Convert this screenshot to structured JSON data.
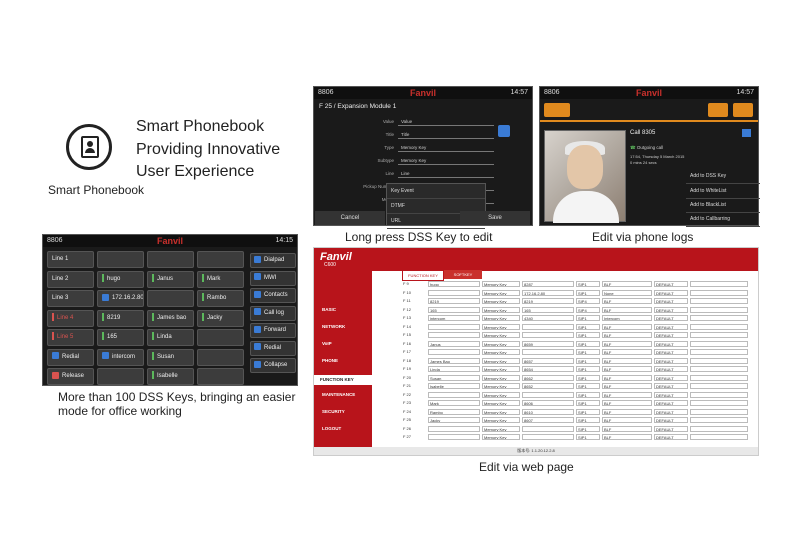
{
  "intro": {
    "icon_caption": "Smart Phonebook",
    "headline": [
      "Smart Phonebook",
      "Providing Innovative",
      "User Experience"
    ]
  },
  "dss_screen": {
    "status_left": "8806",
    "brand": "Fanvil",
    "time": "14:15",
    "cells": [
      {
        "label": "Line 1",
        "led": "none"
      },
      {
        "label": "",
        "led": "none"
      },
      {
        "label": "",
        "led": "none"
      },
      {
        "label": "",
        "led": "none"
      },
      {
        "label": "Line 2",
        "led": "none"
      },
      {
        "label": "hugo",
        "led": "green"
      },
      {
        "label": "Janus",
        "led": "green"
      },
      {
        "label": "Mark",
        "led": "green"
      },
      {
        "label": "Line 3",
        "led": "none"
      },
      {
        "label": "172.16.2.80",
        "led": "icon"
      },
      {
        "label": "",
        "led": "none"
      },
      {
        "label": "Rambo",
        "led": "green"
      },
      {
        "label": "Line 4",
        "led": "red"
      },
      {
        "label": "8219",
        "led": "green"
      },
      {
        "label": "James bao",
        "led": "green"
      },
      {
        "label": "Jacky",
        "led": "green"
      },
      {
        "label": "Line 5",
        "led": "red"
      },
      {
        "label": "165",
        "led": "green"
      },
      {
        "label": "Linda",
        "led": "green"
      },
      {
        "label": "",
        "led": "none"
      },
      {
        "label": "Redial",
        "led": "icon"
      },
      {
        "label": "intercom",
        "led": "icon"
      },
      {
        "label": "Susan",
        "led": "green"
      },
      {
        "label": "",
        "led": "none"
      },
      {
        "label": "Release",
        "led": "icon-red"
      },
      {
        "label": "",
        "led": "none"
      },
      {
        "label": "Isabelle",
        "led": "green"
      },
      {
        "label": "",
        "led": "none"
      }
    ],
    "side_buttons": [
      "Dialpad",
      "MWI",
      "Contacts",
      "Call log",
      "Forward",
      "Redial",
      "Collapse"
    ],
    "caption": "More than 100 DSS Keys, bringing an easier mode for office working"
  },
  "expansion_screen": {
    "status_left": "8806",
    "brand": "Fanvil",
    "time": "14:57",
    "title": "F 25 / Expansion Module 1",
    "fields": [
      {
        "label": "Value",
        "value": "Value"
      },
      {
        "label": "Title",
        "value": "Title"
      },
      {
        "label": "Type",
        "value": "Memory Key"
      },
      {
        "label": "Subtype",
        "value": "Memory Key"
      },
      {
        "label": "Line",
        "value": "Line"
      },
      {
        "label": "Pickup Number",
        "value": ""
      },
      {
        "label": "Media",
        "value": ""
      }
    ],
    "dropdown_options": [
      "Key Event",
      "DTMF",
      "URL"
    ],
    "cancel": "Cancel",
    "save": "Save",
    "caption": "Long press DSS Key to edit"
  },
  "logs_screen": {
    "status_left": "8806",
    "brand": "Fanvil",
    "time": "14:57",
    "call_name": "Call 8305",
    "call_status": "Outgoing call",
    "call_time": "17:54, Thursday 5 March 2015",
    "call_duration": "0 mins 24 secs",
    "menu": [
      "Add to DSS Key",
      "Add to WhiteList",
      "Add to BlackList",
      "Add to Callbarring"
    ],
    "caption": "Edit via phone logs"
  },
  "web_screen": {
    "brand": "Fanvil",
    "model": "C600",
    "tabs": [
      "FUNCTION KEY",
      "SOFTKEY"
    ],
    "nav": [
      "BASIC",
      "NETWORK",
      "VoIP",
      "PHONE",
      "FUNCTION KEY",
      "MAINTENANCE",
      "SECURITY",
      "LOGOUT"
    ],
    "rows": [
      {
        "key": "F 9",
        "name": "hugo",
        "type": "Memory Key",
        "num": "8287",
        "line": "SIP1",
        "sub": "BLF",
        "mode": "DEFAULT"
      },
      {
        "key": "F 10",
        "name": "",
        "type": "Memory Key",
        "num": "172.16.2.80",
        "line": "SIP1",
        "sub": "None",
        "mode": "DEFAULT"
      },
      {
        "key": "F 11",
        "name": "8219",
        "type": "Memory Key",
        "num": "8219",
        "line": "SIP4",
        "sub": "BLF",
        "mode": "DEFAULT"
      },
      {
        "key": "F 12",
        "name": "165",
        "type": "Memory Key",
        "num": "165",
        "line": "SIP4",
        "sub": "BLF",
        "mode": "DEFAULT"
      },
      {
        "key": "F 13",
        "name": "intercom",
        "type": "Memory Key",
        "num": "4340",
        "line": "SIP1",
        "sub": "Intercom",
        "mode": "DEFAULT"
      },
      {
        "key": "F 14",
        "name": "",
        "type": "Memory Key",
        "num": "",
        "line": "SIP1",
        "sub": "BLF",
        "mode": "DEFAULT"
      },
      {
        "key": "F 15",
        "name": "",
        "type": "Memory Key",
        "num": "",
        "line": "SIP1",
        "sub": "BLF",
        "mode": "DEFAULT"
      },
      {
        "key": "F 16",
        "name": "Janus",
        "type": "Memory Key",
        "num": "8659",
        "line": "SIP1",
        "sub": "BLF",
        "mode": "DEFAULT"
      },
      {
        "key": "F 17",
        "name": "",
        "type": "Memory Key",
        "num": "",
        "line": "SIP1",
        "sub": "BLF",
        "mode": "DEFAULT"
      },
      {
        "key": "F 18",
        "name": "James Bao",
        "type": "Memory Key",
        "num": "8657",
        "line": "SIP1",
        "sub": "BLF",
        "mode": "DEFAULT"
      },
      {
        "key": "F 19",
        "name": "Linda",
        "type": "Memory Key",
        "num": "8654",
        "line": "SIP1",
        "sub": "BLF",
        "mode": "DEFAULT"
      },
      {
        "key": "F 20",
        "name": "Susan",
        "type": "Memory Key",
        "num": "8662",
        "line": "SIP1",
        "sub": "BLF",
        "mode": "DEFAULT"
      },
      {
        "key": "F 21",
        "name": "Isabelle",
        "type": "Memory Key",
        "num": "8652",
        "line": "SIP1",
        "sub": "BLF",
        "mode": "DEFAULT"
      },
      {
        "key": "F 22",
        "name": "",
        "type": "Memory Key",
        "num": "",
        "line": "SIP1",
        "sub": "BLF",
        "mode": "DEFAULT"
      },
      {
        "key": "F 23",
        "name": "Mark",
        "type": "Memory Key",
        "num": "8606",
        "line": "SIP1",
        "sub": "BLF",
        "mode": "DEFAULT"
      },
      {
        "key": "F 24",
        "name": "Rambo",
        "type": "Memory Key",
        "num": "8610",
        "line": "SIP1",
        "sub": "BLF",
        "mode": "DEFAULT"
      },
      {
        "key": "F 25",
        "name": "Jacky",
        "type": "Memory Key",
        "num": "8607",
        "line": "SIP1",
        "sub": "BLF",
        "mode": "DEFAULT"
      },
      {
        "key": "F 26",
        "name": "",
        "type": "Memory Key",
        "num": "",
        "line": "SIP1",
        "sub": "BLF",
        "mode": "DEFAULT"
      },
      {
        "key": "F 27",
        "name": "",
        "type": "Memory Key",
        "num": "",
        "line": "SIP1",
        "sub": "BLF",
        "mode": "DEFAULT"
      }
    ],
    "footer": "版本号: 1.1.20.12.2.8",
    "caption": "Edit via web page"
  }
}
